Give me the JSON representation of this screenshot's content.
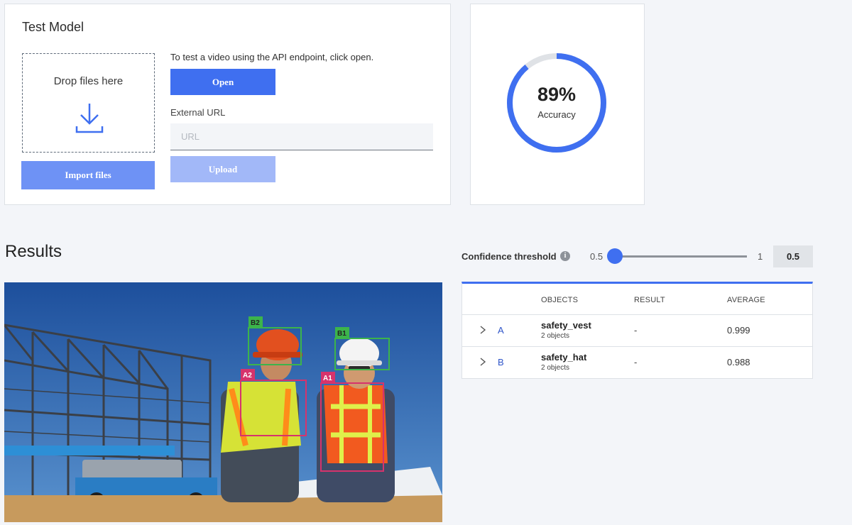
{
  "test_model": {
    "title": "Test Model",
    "dropzone_text": "Drop files here",
    "import_label": "Import files",
    "help_text": "To test a video using the API endpoint, click open.",
    "open_label": "Open",
    "url_label": "External URL",
    "url_placeholder": "URL",
    "url_value": "",
    "upload_label": "Upload"
  },
  "accuracy": {
    "value": "89%",
    "fraction": 0.89,
    "label": "Accuracy",
    "color": "#3f6ff0",
    "track_color": "#dfe2e6"
  },
  "results": {
    "title": "Results",
    "threshold": {
      "label": "Confidence threshold",
      "info_icon": "info-icon",
      "min": "0.5",
      "max": "1",
      "value": "0.5"
    },
    "table": {
      "headers": [
        "OBJECTS",
        "RESULT",
        "AVERAGE"
      ],
      "rows": [
        {
          "id": "A",
          "object": "safety_vest",
          "count": "2 objects",
          "result": "-",
          "average": "0.999"
        },
        {
          "id": "B",
          "object": "safety_hat",
          "count": "2 objects",
          "result": "-",
          "average": "0.988"
        }
      ]
    },
    "detections": [
      {
        "label": "B2",
        "class": "safety_hat",
        "color": "#3cb44b"
      },
      {
        "label": "B1",
        "class": "safety_hat",
        "color": "#3cb44b"
      },
      {
        "label": "A2",
        "class": "safety_vest",
        "color": "#d6336c"
      },
      {
        "label": "A1",
        "class": "safety_vest",
        "color": "#d6336c"
      }
    ]
  },
  "colors": {
    "primary": "#3f6ff0",
    "primary_light": "#6e92f5",
    "primary_disabled": "#a2b8f8",
    "background": "#f3f5f9"
  }
}
